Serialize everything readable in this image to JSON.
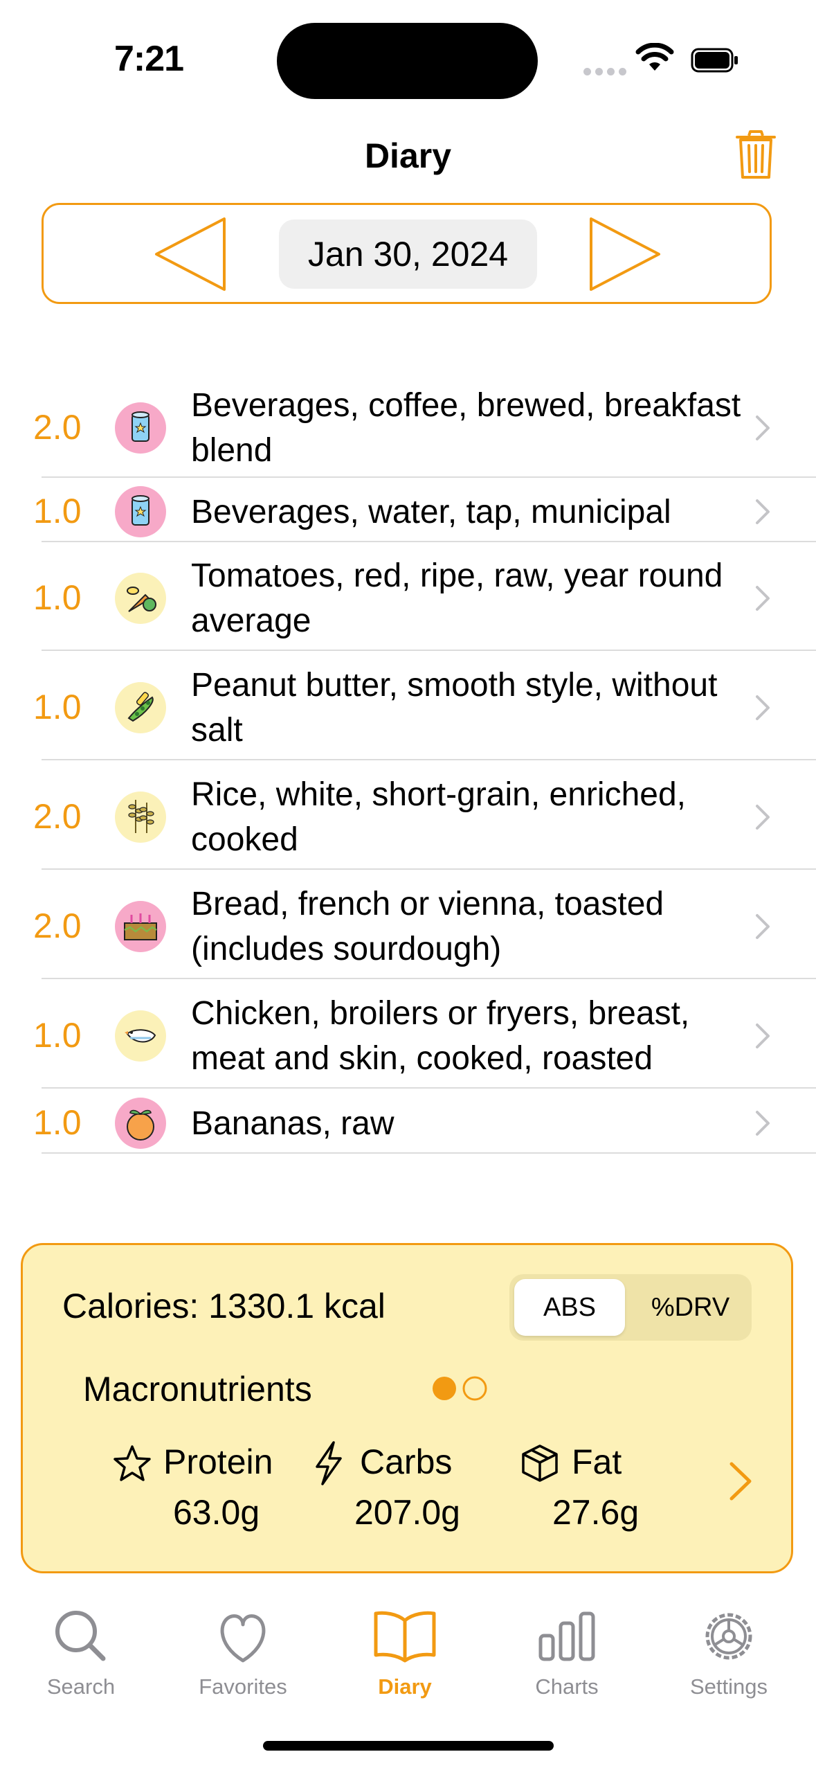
{
  "status_bar": {
    "time": "7:21"
  },
  "header": {
    "title": "Diary"
  },
  "date_nav": {
    "date": "Jan 30, 2024"
  },
  "entries": [
    {
      "qty": "2.0",
      "name": "Beverages, coffee, brewed, breakfast blend",
      "icon": "beverage-can-icon",
      "icon_bg": "#f7a9c8"
    },
    {
      "qty": "1.0",
      "name": "Beverages, water, tap, municipal",
      "icon": "beverage-can-icon",
      "icon_bg": "#f7a9c8"
    },
    {
      "qty": "1.0",
      "name": "Tomatoes, red, ripe, raw, year round average",
      "icon": "vegetables-icon",
      "icon_bg": "#fbf1b8"
    },
    {
      "qty": "1.0",
      "name": "Peanut butter, smooth style, without salt",
      "icon": "legumes-icon",
      "icon_bg": "#fbf1b8"
    },
    {
      "qty": "2.0",
      "name": "Rice, white, short-grain, enriched, cooked",
      "icon": "grain-icon",
      "icon_bg": "#fbf1b8"
    },
    {
      "qty": "2.0",
      "name": "Bread, french or vienna, toasted (includes sourdough)",
      "icon": "baked-goods-icon",
      "icon_bg": "#f7a9c8"
    },
    {
      "qty": "1.0",
      "name": "Chicken, broilers or fryers, breast, meat and skin, cooked, roasted",
      "icon": "poultry-icon",
      "icon_bg": "#fbf1b8"
    },
    {
      "qty": "1.0",
      "name": "Bananas, raw",
      "icon": "fruit-icon",
      "icon_bg": "#f7a9c8"
    }
  ],
  "summary": {
    "calories": "Calories: 1330.1 kcal",
    "toggle": {
      "abs": "ABS",
      "drv": "%DRV",
      "selected": "ABS"
    },
    "section": "Macronutrients",
    "page_indicator": {
      "pages": 2,
      "current": 1
    },
    "protein": {
      "label": "Protein",
      "value": "63.0g"
    },
    "carbs": {
      "label": "Carbs",
      "value": "207.0g"
    },
    "fat": {
      "label": "Fat",
      "value": "27.6g"
    }
  },
  "tabs": [
    {
      "label": "Search",
      "icon": "search-icon"
    },
    {
      "label": "Favorites",
      "icon": "heart-icon"
    },
    {
      "label": "Diary",
      "icon": "book-icon",
      "active": true
    },
    {
      "label": "Charts",
      "icon": "bar-chart-icon"
    },
    {
      "label": "Settings",
      "icon": "gear-icon"
    }
  ],
  "colors": {
    "accent": "#f29a12",
    "card_bg": "#fdf1b8",
    "inactive": "#8e8e93"
  }
}
